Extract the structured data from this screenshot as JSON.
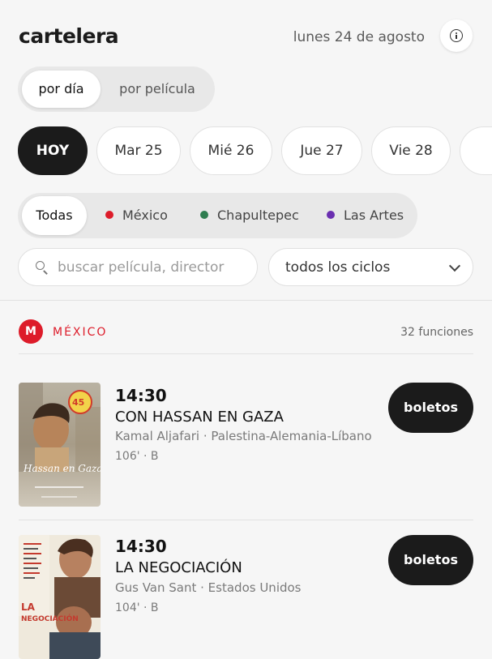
{
  "header": {
    "title": "cartelera",
    "date": "lunes 24 de agosto",
    "info_icon": "info-icon"
  },
  "view_toggle": {
    "options": [
      "por día",
      "por película"
    ],
    "selected": "por día"
  },
  "days": [
    "HOY",
    "Mar 25",
    "Mié 26",
    "Jue 27",
    "Vie 28"
  ],
  "selected_day": "HOY",
  "venues": [
    {
      "label": "Todas",
      "color": ""
    },
    {
      "label": "México",
      "color": "#dd1c2a"
    },
    {
      "label": "Chapultepec",
      "color": "#2e7d4f"
    },
    {
      "label": "Las Artes",
      "color": "#6a2fb0"
    }
  ],
  "selected_venue": "Todas",
  "search": {
    "placeholder": "buscar película, director",
    "icon": "search-icon"
  },
  "cycles_select": {
    "value": "todos los ciclos",
    "icon": "chevron-down-icon"
  },
  "section": {
    "badge": "M",
    "title": "MÉXICO",
    "count": "32 funciones"
  },
  "screenings": [
    {
      "time": "14:30",
      "title": "CON HASSAN EN GAZA",
      "meta": "Kamal Aljafari · Palestina-Alemania-Líbano",
      "duration": "106' · B",
      "button": "boletos",
      "poster": {
        "text": "Hassan en Gaza",
        "badge": "45 FC"
      }
    },
    {
      "time": "14:30",
      "title": "LA NEGOCIACIÓN",
      "meta": "Gus Van Sant · Estados Unidos",
      "duration": "104' · B",
      "button": "boletos",
      "poster": {
        "text": "LA NEGOCIACIÓN"
      }
    }
  ]
}
